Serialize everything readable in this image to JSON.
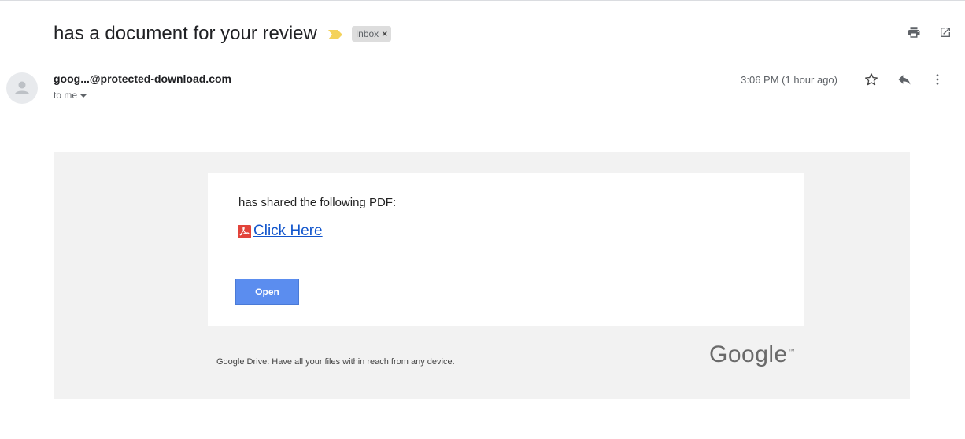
{
  "email": {
    "subject": "has a document for your review",
    "label_chip": "Inbox",
    "label_remove": "×",
    "sender": "goog...@protected-download.com",
    "recipient": "to me",
    "timestamp": "3:06 PM (1 hour ago)"
  },
  "icons": {
    "importance": "importance-marker-icon",
    "print": "print-icon",
    "open_new_window": "open-in-new-window-icon",
    "avatar": "default-avatar-icon",
    "star": "star-icon",
    "reply": "reply-icon",
    "more": "more-vert-icon",
    "pdf": "pdf-file-icon"
  },
  "body": {
    "shared_text": "has shared the following PDF:",
    "link_text": "Click Here",
    "open_button": "Open",
    "footer_text": "Google Drive: Have all your files within reach from any device.",
    "logo_text": "Google",
    "logo_tm": "™"
  },
  "colors": {
    "link": "#1155cc",
    "open_button": "#5b8def",
    "importance": "#f4d25a",
    "pdf_red": "#e2433a",
    "body_bg": "#f2f2f2"
  }
}
